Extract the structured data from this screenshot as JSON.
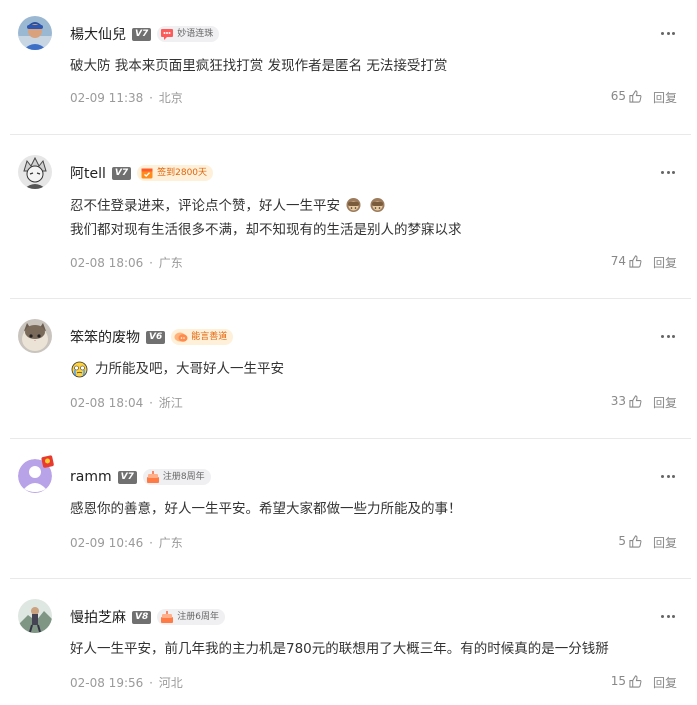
{
  "comments": [
    {
      "username": "楊大仙兒",
      "level": "V7",
      "badge": {
        "label": "妙语连珠",
        "style": "gray",
        "icon": "speech-bubble-icon"
      },
      "text_lines": [
        "破大防 我本来页面里疯狂找打赏 发现作者是匿名 无法接受打赏"
      ],
      "date": "02-09 11:38",
      "location": "北京",
      "likes": "65",
      "reply_label": "回复"
    },
    {
      "username": "阿tell",
      "level": "V7",
      "badge": {
        "label": "签到2800天",
        "style": "orange",
        "icon": "calendar-check-icon"
      },
      "text_lines": [
        "忍不住登录进来，评论点个赞，好人一生平安",
        "我们都对现有生活很多不满，却不知现有的生活是别人的梦寐以求"
      ],
      "date": "02-08 18:06",
      "location": "广东",
      "likes": "74",
      "reply_label": "回复"
    },
    {
      "username": "笨笨的废物",
      "level": "V6",
      "badge": {
        "label": "能言善道",
        "style": "orange",
        "icon": "speech-bubble-icon"
      },
      "text_lines": [
        "力所能及吧，大哥好人一生平安"
      ],
      "date": "02-08 18:04",
      "location": "浙江",
      "likes": "33",
      "reply_label": "回复"
    },
    {
      "username": "ramm",
      "level": "V7",
      "badge": {
        "label": "注册8周年",
        "style": "gray",
        "icon": "cake-icon"
      },
      "text_lines": [
        "感恩你的善意，好人一生平安。希望大家都做一些力所能及的事！"
      ],
      "date": "02-09 10:46",
      "location": "广东",
      "likes": "5",
      "reply_label": "回复"
    },
    {
      "username": "慢拍芝麻",
      "level": "V8",
      "badge": {
        "label": "注册6周年",
        "style": "gray",
        "icon": "cake-icon"
      },
      "text_lines": [
        "好人一生平安，前几年我的主力机是780元的联想用了大概三年。有的时候真的是一分钱掰"
      ],
      "date": "02-08 19:56",
      "location": "河北",
      "likes": "15",
      "reply_label": "回复"
    }
  ],
  "icons": {
    "more": "more-dots-icon",
    "like": "thumbs-up-icon",
    "emoji_monkey": "see-no-evil-monkey-emoji",
    "emoji_crying_face": "crying-face-emoji"
  }
}
